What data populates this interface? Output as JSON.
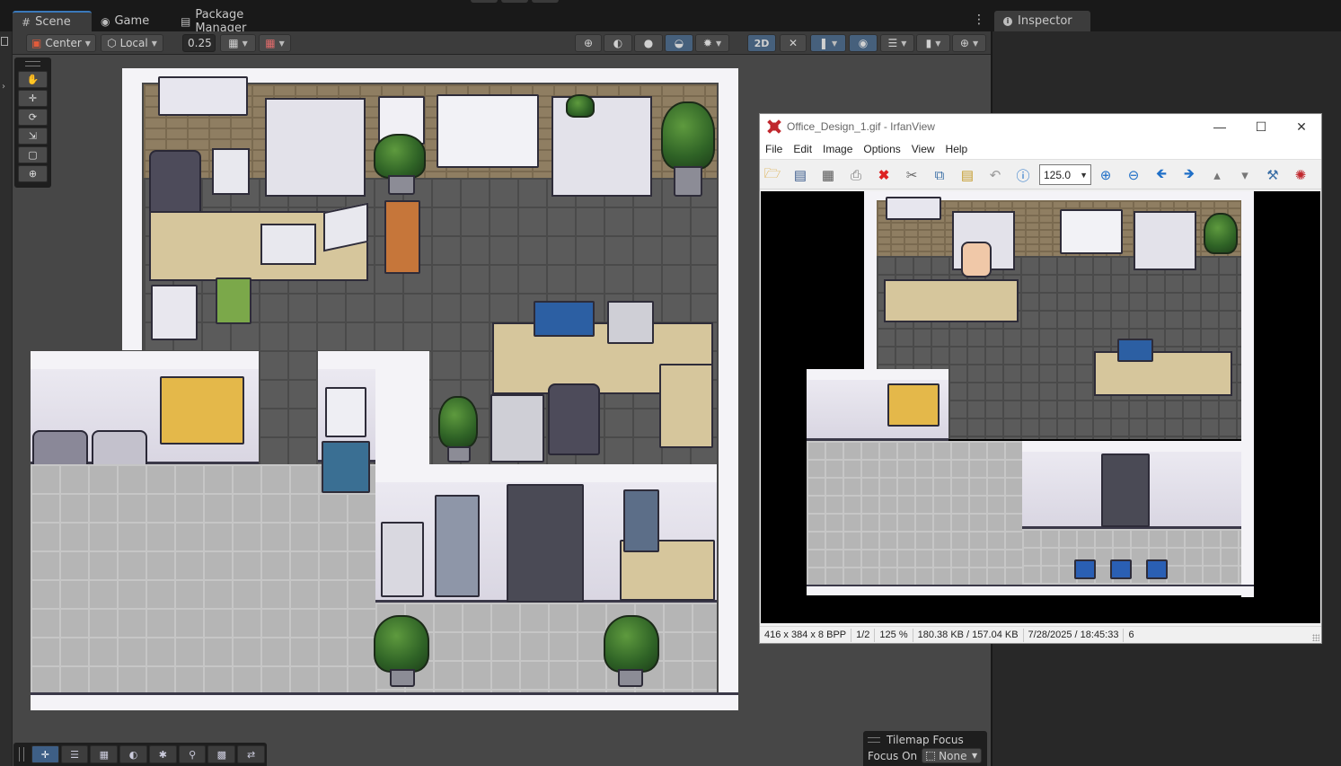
{
  "tabs": {
    "scene": "Scene",
    "game": "Game",
    "package_manager": "Package Manager",
    "inspector": "Inspector"
  },
  "scene_toolbar": {
    "pivot": "Center",
    "space": "Local",
    "grid_snap_value": "0.25",
    "mode_2d": "2D"
  },
  "tools": [
    "hand-tool",
    "move-tool",
    "rotate-tool",
    "scale-tool",
    "rect-tool",
    "transform-tool"
  ],
  "tilemap_focus": {
    "title": "Tilemap Focus",
    "focus_on_label": "Focus On",
    "focus_on_value": "None"
  },
  "irfanview": {
    "title": "Office_Design_1.gif - IrfanView",
    "menu": [
      "File",
      "Edit",
      "Image",
      "Options",
      "View",
      "Help"
    ],
    "zoom_value": "125.0",
    "status": {
      "dimensions": "416 x 384 x 8 BPP",
      "page": "1/2",
      "zoom": "125 %",
      "size": "180.38 KB / 157.04 KB",
      "datetime": "7/28/2025 / 18:45:33",
      "extra": "6"
    }
  },
  "colors": {
    "accent": "#3a79bb",
    "toolbar_active": "#46607c",
    "bg_dark": "#191919",
    "viewport": "#474747"
  }
}
